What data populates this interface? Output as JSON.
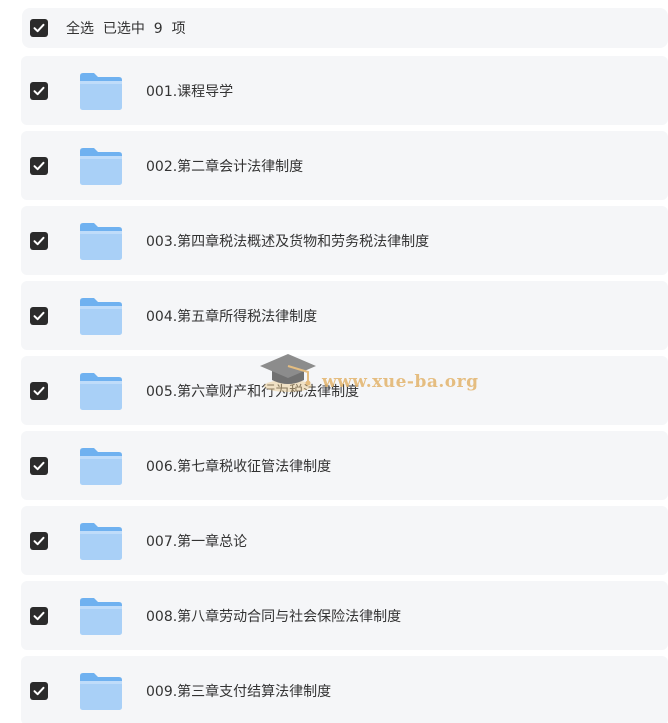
{
  "header": {
    "select_all_label": "全选  已选中  9  项",
    "checked": true
  },
  "items": [
    {
      "label": "001.课程导学",
      "checked": true,
      "icon": "folder-icon"
    },
    {
      "label": "002.第二章会计法律制度",
      "checked": true,
      "icon": "folder-icon"
    },
    {
      "label": "003.第四章税法概述及货物和劳务税法律制度",
      "checked": true,
      "icon": "folder-icon"
    },
    {
      "label": "004.第五章所得税法律制度",
      "checked": true,
      "icon": "folder-icon"
    },
    {
      "label": "005.第六章财产和行为税法律制度",
      "checked": true,
      "icon": "folder-icon"
    },
    {
      "label": "006.第七章税收征管法律制度",
      "checked": true,
      "icon": "folder-icon"
    },
    {
      "label": "007.第一章总论",
      "checked": true,
      "icon": "folder-icon"
    },
    {
      "label": "008.第八章劳动合同与社会保险法律制度",
      "checked": true,
      "icon": "folder-icon"
    },
    {
      "label": "009.第三章支付结算法律制度",
      "checked": true,
      "icon": "folder-icon"
    }
  ],
  "watermark": {
    "text": "www.xue-ba.org",
    "icon": "graduation-cap-icon"
  },
  "colors": {
    "row_bg": "#f5f6f8",
    "checkbox": "#2b2b2b",
    "folder_light": "#a9d0f7",
    "folder_dark": "#6fb1f0",
    "watermark": "#e3b46c"
  }
}
